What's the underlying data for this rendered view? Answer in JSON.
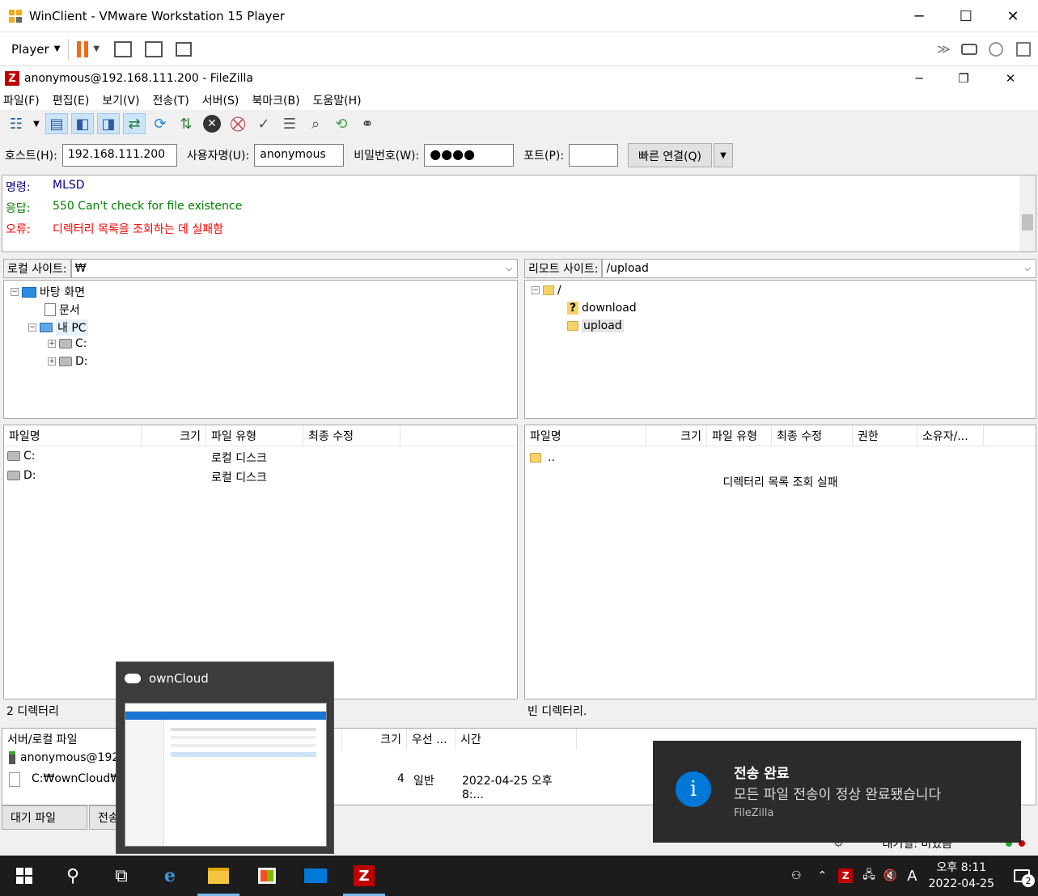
{
  "vm": {
    "title": "WinClient - VMware Workstation 15 Player",
    "player_label": "Player",
    "window_controls": {
      "min": "─",
      "max": "☐",
      "close": "✕"
    }
  },
  "fz": {
    "title": "anonymous@192.168.111.200 - FileZilla",
    "window_controls": {
      "min": "─",
      "max": "❐",
      "close": "✕"
    },
    "menu": [
      "파일(F)",
      "편집(E)",
      "보기(V)",
      "전송(T)",
      "서버(S)",
      "북마크(B)",
      "도움말(H)"
    ],
    "quick": {
      "host_label": "호스트(H):",
      "host_value": "192.168.111.200",
      "user_label": "사용자명(U):",
      "user_value": "anonymous",
      "pass_label": "비밀번호(W):",
      "pass_value": "●●●●",
      "port_label": "포트(P):",
      "port_value": "",
      "connect_label": "빠른 연결(Q)"
    },
    "log": [
      {
        "k": "명령:",
        "v": "MLSD",
        "color": "#00008b"
      },
      {
        "k": "응답:",
        "v": "550 Can't check for file existence",
        "color": "#008000"
      },
      {
        "k": "오류:",
        "v": "디렉터리 목록을 조회하는 데 실패함",
        "color": "#ff0000"
      }
    ],
    "local": {
      "site_label": "로컬 사이트:",
      "path": "₩",
      "tree": {
        "desktop": "바탕 화면",
        "docs": "문서",
        "pc": "내 PC",
        "c": "C:",
        "d": "D:"
      },
      "headers": [
        "파일명",
        "크기",
        "파일 유형",
        "최종 수정"
      ],
      "rows": [
        {
          "name": "C:",
          "type": "로컬 디스크"
        },
        {
          "name": "D:",
          "type": "로컬 디스크"
        }
      ],
      "status": "2 디렉터리"
    },
    "remote": {
      "site_label": "리모트 사이트:",
      "path": "/upload",
      "tree": {
        "root": "/",
        "download": "download",
        "upload": "upload"
      },
      "headers": [
        "파일명",
        "크기",
        "파일 유형",
        "최종 수정",
        "권한",
        "소유자/..."
      ],
      "parent": "..",
      "error": "디렉터리 목록 조회 실패",
      "status": "빈 디렉터리."
    },
    "queue": {
      "headers": [
        "서버/로컬 파일",
        "크기",
        "우선 ...",
        "시간"
      ],
      "server": "anonymous@192.",
      "file": "C:₩ownCloud₩T",
      "size": "4",
      "priority": "일반",
      "time": "2022-04-25 오후 8:...",
      "tabs": [
        "대기 파일",
        "전송"
      ],
      "status_right": "대기열: 비었음"
    }
  },
  "thumb": {
    "title": "ownCloud"
  },
  "toast": {
    "title": "전송 완료",
    "body": "모든 파일 전송이 정상 완료됐습니다",
    "app": "FileZilla"
  },
  "taskbar": {
    "time": "오후 8:11",
    "date": "2022-04-25",
    "ime": "A",
    "notif_count": "2"
  }
}
